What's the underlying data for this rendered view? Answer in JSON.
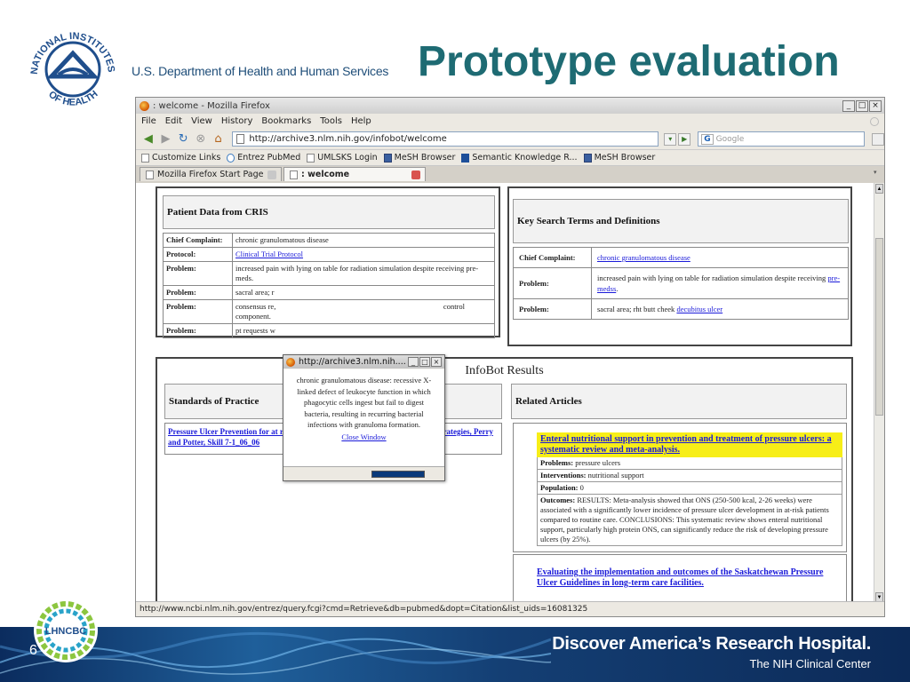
{
  "slide": {
    "title": "Prototype evaluation",
    "hhs": "U.S. Department of Health and Human Services",
    "nih_seal_text": "NATIONAL INSTITUTES OF HEALTH",
    "footer_line1": "Discover America’s Research Hospital.",
    "footer_line2": "The NIH Clinical Center",
    "lhncbc": "LHNCBC",
    "slide_number": "6"
  },
  "browser": {
    "window_title": ": welcome - Mozilla Firefox",
    "menus": [
      "File",
      "Edit",
      "View",
      "History",
      "Bookmarks",
      "Tools",
      "Help"
    ],
    "url": "http://archive3.nlm.nih.gov/infobot/welcome",
    "search_placeholder": "Google",
    "bookmarks": [
      "Customize Links",
      "Entrez PubMed",
      "UMLSKS Login",
      "MeSH Browser",
      "Semantic Knowledge R...",
      "MeSH Browser"
    ],
    "tabs": [
      "Mozilla Firefox Start Page",
      ": welcome"
    ],
    "status": "http://www.ncbi.nlm.nih.gov/entrez/query.fcgi?cmd=Retrieve&db=pubmed&dopt=Citation&list_uids=16081325"
  },
  "cris": {
    "title": "Patient Data from CRIS",
    "rows": [
      {
        "label": "Chief Complaint:",
        "value": "chronic granulomatous disease"
      },
      {
        "label": "Protocol:",
        "value": "Clinical Trial Protocol"
      },
      {
        "label": "Problem:",
        "value": "increased pain with lying on table for radiation simulation despite receiving pre-meds."
      },
      {
        "label": "Problem:",
        "value": "sacral area; r"
      },
      {
        "label": "Problem:",
        "value": "consensus re,",
        "value_tail": "control",
        "value2": "component."
      },
      {
        "label": "Problem:",
        "value": "pt requests w"
      }
    ]
  },
  "key_terms": {
    "title": "Key Search Terms and Definitions",
    "rows": [
      {
        "label": "Chief Complaint:",
        "link": "chronic granulomatous disease"
      },
      {
        "label": "Problem:",
        "text": "increased pain with lying on table for radiation simulation despite receiving ",
        "link": "pre-medss",
        "tail": "."
      },
      {
        "label": "Problem:",
        "text": "sacral area; rht butt cheek ",
        "link": "decubitus ulcer"
      }
    ]
  },
  "infobot": {
    "title": "InfoBot Results",
    "sop_head": "Standards of Practice",
    "rel_head": "Related Articles",
    "sop_link": "Pressure Ulcer Prevention for at risk Patient, Risk Assessment and Prevention Strategies, Perry and Potter, Skill 7-1_06_06",
    "article1": {
      "title": "Enteral nutritional support in prevention and treatment of pressure ulcers: a systematic review and meta-analysis.",
      "problems_label": "Problems:",
      "problems": "pressure ulcers",
      "interventions_label": "Interventions:",
      "interventions": "nutritional support",
      "population_label": "Population:",
      "population": "0",
      "outcomes_label": "Outcomes:",
      "outcomes": "RESULTS: Meta-analysis showed that ONS (250-500 kcal, 2-26 weeks) were associated with a significantly lower incidence of pressure ulcer development in at-risk patients compared to routine care. CONCLUSIONS: This systematic review shows enteral nutritional support, particularly high protein ONS, can significantly reduce the risk of developing pressure ulcers (by 25%)."
    },
    "article2": {
      "title": "Evaluating the implementation and outcomes of the Saskatchewan Pressure Ulcer Guidelines in long-term care facilities."
    }
  },
  "popup": {
    "title": "http://archive3.nlm.nih....",
    "body": "chronic granulomatous disease: recessive X-linked defect of leukocyte function in which phagocytic cells ingest but fail to digest bacteria, resulting in recurring bacterial infections with granuloma formation.",
    "close": "Close Window"
  },
  "colors": {
    "title": "#1e6b73",
    "footer": "#0b2c5e",
    "highlight": "#f7ee18",
    "link": "#1a1ad9"
  }
}
